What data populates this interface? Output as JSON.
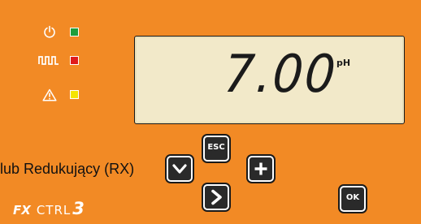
{
  "indicators": [
    {
      "icon": "power-icon",
      "led_color": "#1e9e3c"
    },
    {
      "icon": "pulse-icon",
      "led_color": "#e01c1c"
    },
    {
      "icon": "warning-icon",
      "led_color": "#f5e400"
    }
  ],
  "display": {
    "value": "7.00",
    "unit": "pH"
  },
  "keys": {
    "esc_label": "ESC",
    "ok_label": "OK"
  },
  "caption": "lub Redukujący (RX)",
  "brand": {
    "prefix": "FX",
    "name": "CTRL",
    "version": "3"
  },
  "colors": {
    "panel": "#f28a25",
    "lcd": "#f2e9c9"
  }
}
